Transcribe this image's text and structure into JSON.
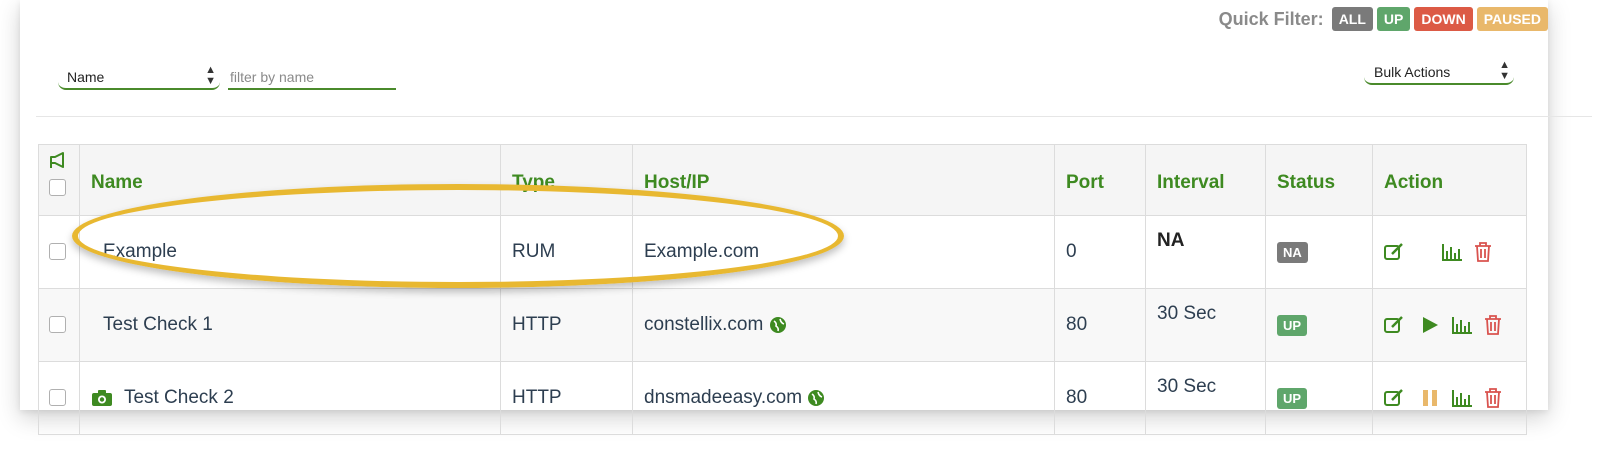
{
  "quick_filter": {
    "label": "Quick Filter:",
    "buttons": [
      {
        "label": "ALL",
        "color": "#7a7a7a"
      },
      {
        "label": "UP",
        "color": "#5fa66b"
      },
      {
        "label": "DOWN",
        "color": "#dc5a45"
      },
      {
        "label": "PAUSED",
        "color": "#e9b86b"
      }
    ]
  },
  "filters": {
    "field_select": "Name",
    "search_placeholder": "filter by name",
    "bulk_actions": "Bulk Actions"
  },
  "table": {
    "columns": [
      "Name",
      "Type",
      "Host/IP",
      "Port",
      "Interval",
      "Status",
      "Action"
    ],
    "rows": [
      {
        "name": "Example",
        "type": "RUM",
        "host": "Example.com",
        "port": "0",
        "interval": "NA",
        "status": "NA",
        "status_color": "#7a7a7a",
        "highlighted": true
      },
      {
        "name": "Test Check 1",
        "type": "HTTP",
        "host": "constellix.com",
        "port": "80",
        "interval": "30 Sec",
        "status": "UP",
        "status_color": "#5fa66b",
        "action": "play-icon"
      },
      {
        "name": "Test Check 2",
        "type": "HTTP",
        "host": "dnsmadeeasy.com",
        "port": "80",
        "interval": "30 Sec",
        "status": "UP",
        "status_color": "#5fa66b",
        "action": "pause-icon",
        "name_icon": "camera-icon"
      }
    ]
  },
  "colors": {
    "accent_green": "#3e8a21",
    "highlight": "#e8b831",
    "delete_red": "#d9534f"
  }
}
